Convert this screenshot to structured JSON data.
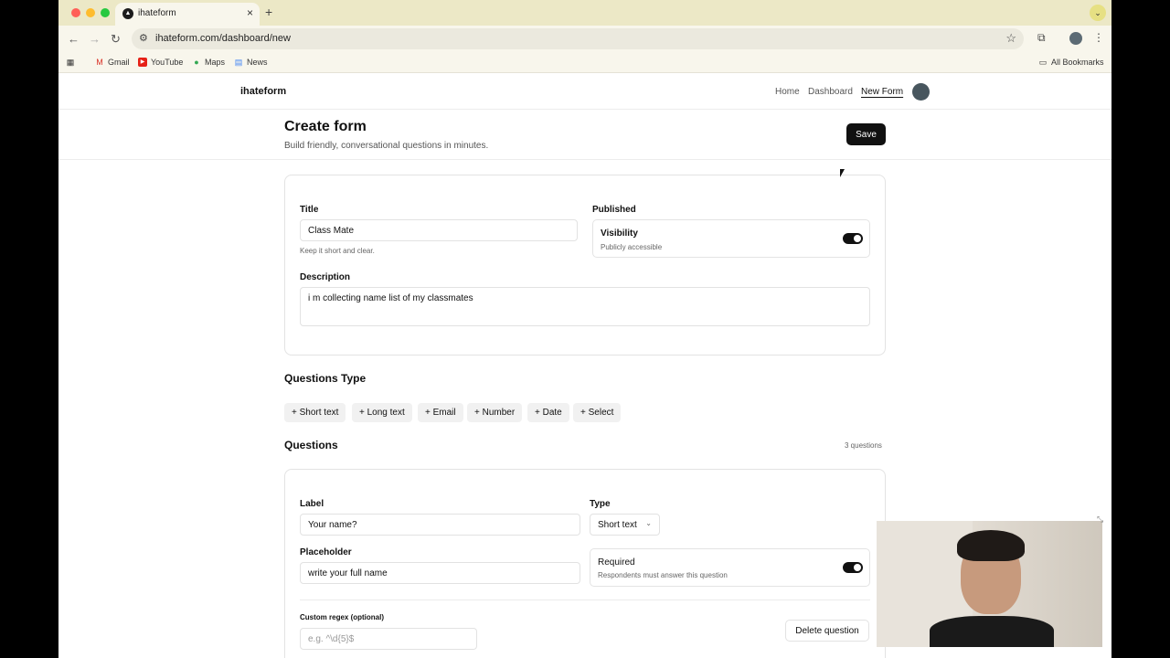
{
  "browser": {
    "tab_title": "ihateform",
    "url": "ihateform.com/dashboard/new",
    "bookmarks": [
      "Gmail",
      "YouTube",
      "Maps",
      "News"
    ],
    "all_bookmarks": "All Bookmarks"
  },
  "header": {
    "brand": "ihateform",
    "nav": [
      "Home",
      "Dashboard",
      "New Form"
    ]
  },
  "page": {
    "title": "Create form",
    "subtitle": "Build friendly, conversational questions in minutes.",
    "save_label": "Save"
  },
  "form_settings": {
    "title_label": "Title",
    "title_value": "Class Mate",
    "title_hint": "Keep it short and clear.",
    "published_label": "Published",
    "visibility_label": "Visibility",
    "visibility_hint": "Publicly accessible",
    "visibility_on": true,
    "description_label": "Description",
    "description_value": "i m collecting name list of my classmates"
  },
  "question_types": {
    "heading": "Questions Type",
    "chips": [
      "+ Short text",
      "+ Long text",
      "+ Email",
      "+ Number",
      "+ Date",
      "+ Select"
    ]
  },
  "questions": {
    "heading": "Questions",
    "count": "3 questions",
    "items": [
      {
        "label_label": "Label",
        "label_value": "Your name?",
        "type_label": "Type",
        "type_value": "Short text",
        "placeholder_label": "Placeholder",
        "placeholder_value": "write your full name",
        "required_label": "Required",
        "required_hint": "Respondents must answer this question",
        "required_on": true,
        "regex_label": "Custom regex (optional)",
        "regex_placeholder": "e.g. ^\\d{5}$",
        "delete_label": "Delete question"
      }
    ]
  },
  "colors": {
    "accent": "#111111",
    "tabstrip": "#ece8c6",
    "chip": "#f1f1f1"
  }
}
